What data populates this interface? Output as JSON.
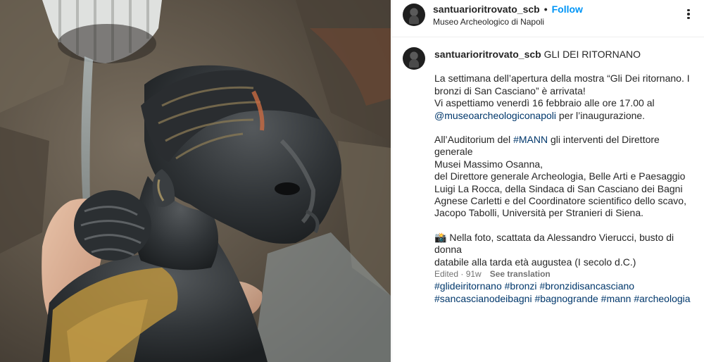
{
  "post": {
    "username": "santuarioritrovato_scb",
    "separator": "•",
    "follow_label": "Follow",
    "location": "Museo Archeologico di Napoli"
  },
  "caption": {
    "username": "santuarioritrovato_scb",
    "title": "GLI DEI RITORNANO",
    "p1_line1": "La settimana dell’apertura della mostra “Gli Dei ritornano. I",
    "p1_line2": "bronzi di San Casciano” è arrivata!",
    "p1_line3": "Vi aspettiamo venerdì 16 febbraio alle ore 17.00 al",
    "p1_mention": "@museoarcheologiconapoli",
    "p1_after_mention": " per l’inaugurazione.",
    "p2_prefix": "All’Auditorium del ",
    "p2_hashtag": "#MANN",
    "p2_line1_rest": " gli interventi del Direttore generale",
    "p2_line2": "Musei Massimo Osanna,",
    "p2_line3": "del Direttore generale Archeologia, Belle Arti e Paesaggio",
    "p2_line4": "Luigi La Rocca, della Sindaca di San Casciano dei Bagni",
    "p2_line5": "Agnese Carletti e del Coordinatore scientifico dello scavo,",
    "p2_line6": "Jacopo Tabolli, Università per Stranieri di Siena.",
    "p3_emoji": "📸",
    "p3_line1": " Nella foto, scattata da Alessandro Vierucci, busto di donna",
    "p3_line2": "databile alla tarda età augustea (I secolo d.C.)",
    "hashtags_line1": [
      "#glideiritornano",
      "#bronzi",
      "#bronzidisancasciano"
    ],
    "hashtags_line2": [
      "#sancascianodeibagni",
      "#bagnogrande",
      "#mann",
      "#archeologia"
    ]
  },
  "meta": {
    "edited": "Edited · 91w",
    "see_translation": "See translation"
  },
  "icons": {
    "avatar": "profile-avatar",
    "more": "more-options-icon"
  },
  "colors": {
    "link_blue": "#0095f6",
    "mention_navy": "#00376b",
    "text": "#262626",
    "muted": "#737373"
  }
}
